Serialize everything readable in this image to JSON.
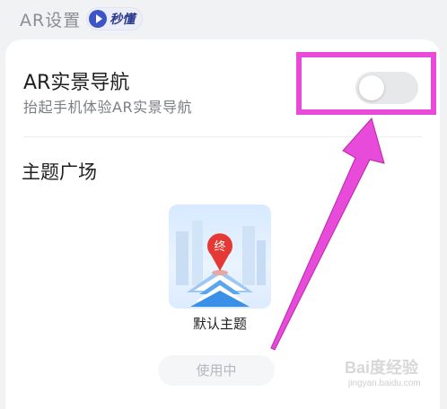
{
  "section": {
    "title": "AR设置",
    "badge_text": "秒懂",
    "badge_icon": "play-icon"
  },
  "ar_nav": {
    "title": "AR实景导航",
    "subtitle": "抬起手机体验AR实景导航",
    "toggle_on": false
  },
  "themes": {
    "title": "主题广场",
    "items": [
      {
        "name": "默认主题",
        "pin_label": "终",
        "status_button": "使用中"
      }
    ]
  },
  "watermark": {
    "logo": "Bai度经验",
    "url": "jingyan.baidu.com"
  },
  "colors": {
    "highlight": "#e84ad9",
    "badge_accent": "#3b54c8",
    "pin": "#e53935"
  }
}
